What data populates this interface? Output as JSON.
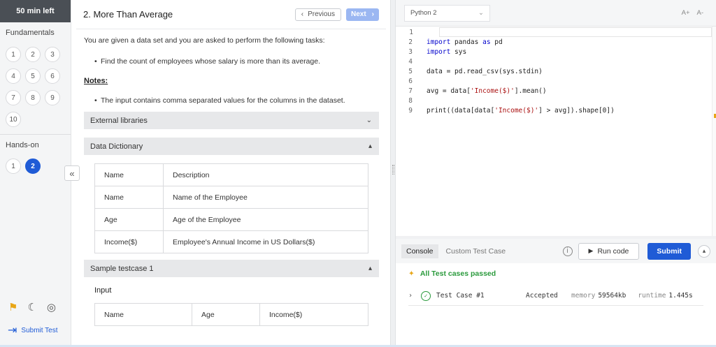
{
  "sidebar": {
    "timer": "50 min left",
    "fundamentals_title": "Fundamentals",
    "fundamentals": [
      "1",
      "2",
      "3",
      "4",
      "5",
      "6",
      "7",
      "8",
      "9",
      "10"
    ],
    "handson_title": "Hands-on",
    "handson": [
      "1",
      "2"
    ],
    "active_handson": "2",
    "submit_test": "Submit Test"
  },
  "question": {
    "title": "2. More Than Average",
    "prev_label": "Previous",
    "next_label": "Next",
    "intro": "You are given a data set and you are asked to perform the following tasks:",
    "task": "Find the count of employees whose salary is more than its average.",
    "notes_label": "Notes:",
    "note": "The input contains comma separated values for the columns in the dataset.",
    "sections": {
      "external": "External libraries",
      "dictionary": "Data Dictionary",
      "sample": "Sample testcase 1"
    },
    "dictionary_table": {
      "headers": [
        "Name",
        "Description"
      ],
      "rows": [
        [
          "Name",
          "Name of the Employee"
        ],
        [
          "Age",
          "Age of the Employee"
        ],
        [
          "Income($)",
          "Employee's Annual Income in US Dollars($)"
        ]
      ]
    },
    "input_label": "Input",
    "sample_headers": [
      "Name",
      "Age",
      "Income($)"
    ]
  },
  "editor": {
    "language": "Python 2",
    "font_up": "A+",
    "font_down": "A-",
    "lines": [
      {
        "n": "1",
        "t": ""
      },
      {
        "n": "2",
        "t": "import pandas as pd"
      },
      {
        "n": "3",
        "t": "import sys"
      },
      {
        "n": "4",
        "t": ""
      },
      {
        "n": "5",
        "t": "data = pd.read_csv(sys.stdin)"
      },
      {
        "n": "6",
        "t": ""
      },
      {
        "n": "7",
        "t": "avg = data['Income($)'].mean()"
      },
      {
        "n": "8",
        "t": ""
      },
      {
        "n": "9",
        "t": "print((data[data['Income($)'] > avg]).shape[0])"
      }
    ]
  },
  "console": {
    "tab_console": "Console",
    "tab_custom": "Custom Test Case",
    "run_label": "Run code",
    "submit_label": "Submit",
    "passed_msg": "All Test cases passed",
    "case": {
      "name": "Test Case #1",
      "status": "Accepted",
      "memory_label": "memory",
      "memory": "59564kb",
      "runtime_label": "runtime",
      "runtime": "1.445s"
    }
  }
}
